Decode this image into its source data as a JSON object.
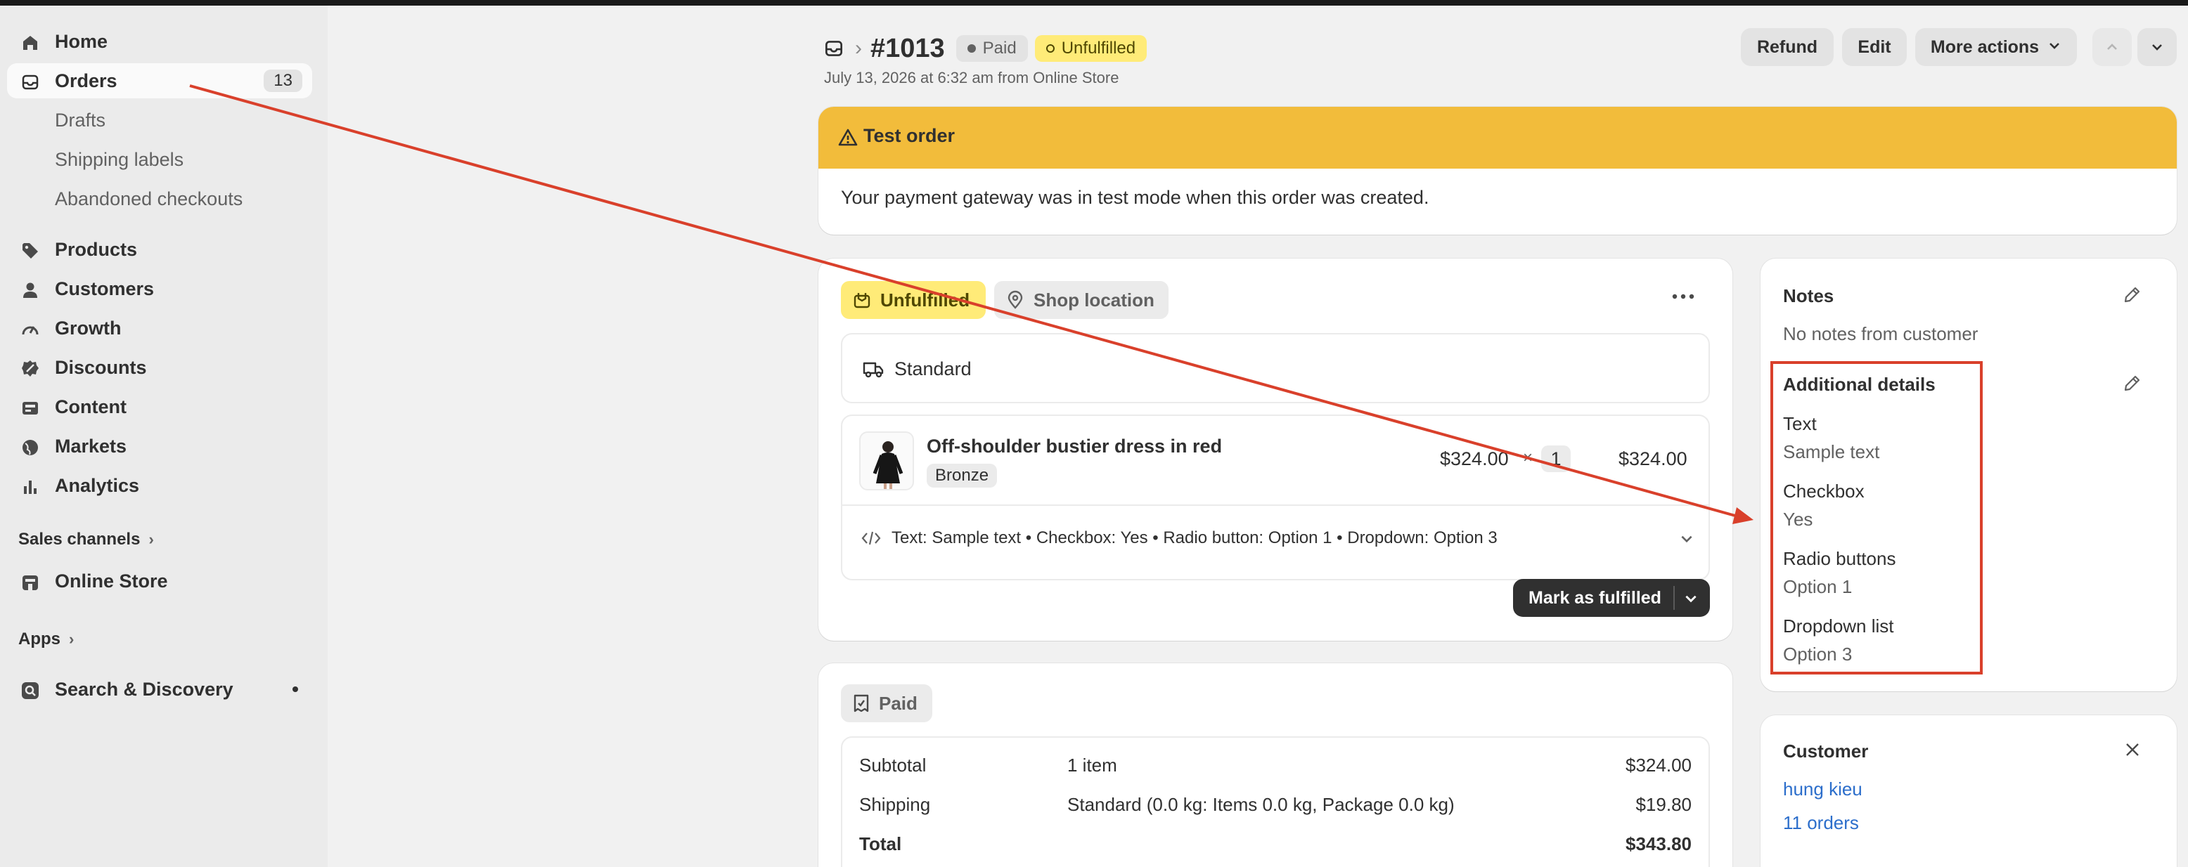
{
  "sidebar": {
    "home": "Home",
    "orders": "Orders",
    "orders_count": "13",
    "drafts": "Drafts",
    "shipping_labels": "Shipping labels",
    "abandoned_checkouts": "Abandoned checkouts",
    "products": "Products",
    "customers": "Customers",
    "growth": "Growth",
    "discounts": "Discounts",
    "content": "Content",
    "markets": "Markets",
    "analytics": "Analytics",
    "sales_channels": "Sales channels",
    "online_store": "Online Store",
    "apps": "Apps",
    "search_discovery": "Search & Discovery"
  },
  "header": {
    "order_number": "#1013",
    "payment_status": "Paid",
    "fulfillment_status": "Unfulfilled",
    "subtitle": "July 13, 2026 at 6:32 am from Online Store",
    "refund": "Refund",
    "edit": "Edit",
    "more_actions": "More actions"
  },
  "banner": {
    "title": "Test order",
    "body": "Your payment gateway was in test mode when this order was created."
  },
  "fulfillment": {
    "status": "Unfulfilled",
    "location": "Shop location",
    "shipping_method": "Standard",
    "item_name": "Off-shoulder bustier dress in red",
    "item_variant": "Bronze",
    "unit_price": "$324.00",
    "times": "×",
    "quantity": "1",
    "line_total": "$324.00",
    "properties": "Text: Sample text • Checkbox: Yes • Radio button: Option 1 • Dropdown: Option 3",
    "mark_fulfilled": "Mark as fulfilled"
  },
  "payment": {
    "status": "Paid",
    "rows": [
      {
        "label": "Subtotal",
        "detail": "1 item",
        "amount": "$324.00"
      },
      {
        "label": "Shipping",
        "detail": "Standard (0.0 kg: Items 0.0 kg, Package 0.0 kg)",
        "amount": "$19.80"
      },
      {
        "label": "Total",
        "detail": "",
        "amount": "$343.80"
      }
    ]
  },
  "notes": {
    "title": "Notes",
    "body": "No notes from customer"
  },
  "additional_details": {
    "title": "Additional details",
    "fields": [
      {
        "label": "Text",
        "value": "Sample text"
      },
      {
        "label": "Checkbox",
        "value": "Yes"
      },
      {
        "label": "Radio buttons",
        "value": "Option 1"
      },
      {
        "label": "Dropdown list",
        "value": "Option 3"
      }
    ]
  },
  "customer": {
    "title": "Customer",
    "name": "hung kieu",
    "orders": "11 orders"
  },
  "colors": {
    "annotation": "#d9402b",
    "banner": "#f2bc3b",
    "unfulfilled_badge": "#ffeb78",
    "link": "#2c6ecb"
  }
}
